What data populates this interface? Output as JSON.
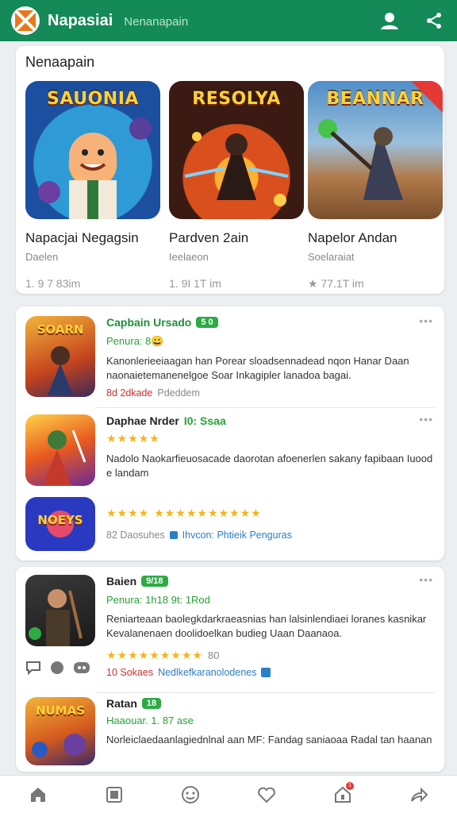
{
  "appbar": {
    "title": "Napasiai",
    "subtitle": "Nenanapain",
    "icons": [
      "logo-icon",
      "profile-icon",
      "share-icon"
    ]
  },
  "featured": {
    "title": "Nenaapain",
    "items": [
      {
        "art_title": "SAUONIA",
        "name": "Napacjai Negagsin",
        "sub": "Daelen",
        "stat": "1. 9 7 83im"
      },
      {
        "art_title": "RESOLYA",
        "name": "Pardven 2ain",
        "sub": "Ieelaeon",
        "stat": "1. 9I 1T im"
      },
      {
        "art_title": "BEANNAR",
        "name": "Napelor Andan",
        "sub": "Soelaraiat",
        "stat": "★ 77.1T im"
      }
    ]
  },
  "list_a": [
    {
      "thumb": "SOARN",
      "title": "Capbain Ursado",
      "badge": "5 0",
      "meta": "Penura: 8😀",
      "desc": "Kanonlerieeiaagan han Porear sloadsennadead nqon Hanar Daan naonaietemanenelgoe Soar Inkagipler lanadoa bagai.",
      "foot_red": "8d 2dkade",
      "foot_gray": "Pdeddem"
    },
    {
      "thumb": "",
      "title": "Daphae Nrder",
      "title_green": "I0: Ssaa",
      "stars": "★★★★★",
      "desc": "Nadolo Naokarfieuosacade daorotan afoenerlen sakany fapibaan Iuood e landam"
    },
    {
      "thumb": "NOEYS",
      "stars_a": "★★★★",
      "stars_b": "★★★★★★★★★★",
      "foot_gray": "82 Daosuhes",
      "foot_blue": "Ihvcon: Phtieik Penguras"
    }
  ],
  "list_b": [
    {
      "thumb": "",
      "title": "Baien",
      "badge": "9/18",
      "meta": "Penura: 1h18 9t: 1Rod",
      "desc": "Reniarteaan baolegkdarkraeasnias han lalsinlendiaei loranes kasnikar Kevalanenaen doolidoelkan budieg Uaan Daanaoa.",
      "stars": "★★★★★★★★★",
      "stars_num": "80",
      "foot_red": "10 Sokaes",
      "foot_blue": "Nedlkefkaranolodenes"
    },
    {
      "thumb": "NUMAS",
      "title": "Ratan",
      "badge": "18",
      "meta": "Haaouar. 1. 87 ase",
      "desc": "Norleiclaedaanlagiednlnal aan MF: Fandag saniaoaa Radal tan haanan"
    }
  ],
  "bottomnav": [
    "home-icon",
    "library-icon",
    "games-icon",
    "heart-icon",
    "notifications-icon",
    "share-icon"
  ],
  "notif_count": "1",
  "colors": {
    "primary": "#138a58",
    "accent_green": "#27a236",
    "red": "#d03030",
    "blue": "#2a7fc9",
    "star": "#f3b51a"
  }
}
